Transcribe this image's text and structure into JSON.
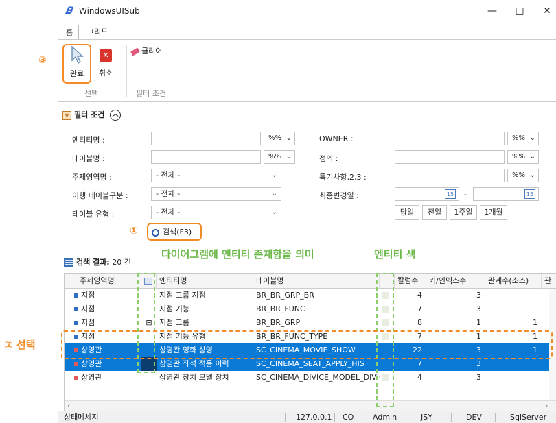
{
  "window": {
    "title": "WindowsUISub",
    "minimize": "—",
    "maximize": "□",
    "close": "✕"
  },
  "menu": {
    "tabs": [
      "홈",
      "그리드"
    ]
  },
  "ribbon": {
    "complete_label": "완료",
    "cancel_label": "취소",
    "clear_label": "클리어",
    "group_select": "선택",
    "group_filter": "필터 조건"
  },
  "filter": {
    "header": "필터 조건",
    "left": [
      {
        "label": "엔티티명 :",
        "kind": "text",
        "op": "%%"
      },
      {
        "label": "테이블명 :",
        "kind": "text",
        "op": "%%"
      },
      {
        "label": "주제영역명 :",
        "kind": "combo",
        "value": "- 전체 -"
      },
      {
        "label": "이행 테이블구분 :",
        "kind": "combo",
        "value": "- 전체 -"
      },
      {
        "label": "테이블 유형 :",
        "kind": "combo",
        "value": "- 전체 -"
      }
    ],
    "right": [
      {
        "label": "OWNER :",
        "op": "%%"
      },
      {
        "label": "정의 :",
        "op": "%%"
      },
      {
        "label": "특기사항,2,3 :",
        "op": "%%"
      },
      {
        "label": "최종변경일 :"
      }
    ],
    "date_sep": "-",
    "calendar_day": "15",
    "date_buttons": [
      "당일",
      "전일",
      "1주일",
      "1개월"
    ],
    "search_label": "검색(F3)"
  },
  "results": {
    "label": "검색 결과:",
    "count": "20 건",
    "columns": [
      "주제영역명",
      "",
      "엔티티명",
      "테이블명",
      "",
      "칼럼수",
      "키/인덱스수",
      "관계수(소스)",
      "관"
    ],
    "rows": [
      {
        "area": "지점",
        "color": "#2f6fbf",
        "marker": "",
        "entity": "지점 그룹 지점",
        "table": "BR_BR_GRP_BR",
        "cols": "4",
        "keys": "3",
        "rels": "",
        "selected": false
      },
      {
        "area": "지점",
        "color": "#2f6fbf",
        "marker": "",
        "entity": "지점 기능",
        "table": "BR_BR_FUNC",
        "cols": "7",
        "keys": "3",
        "rels": "",
        "selected": false
      },
      {
        "area": "지점",
        "color": "#2f6fbf",
        "marker": "⊟",
        "entity": "지점 그룹",
        "table": "BR_BR_GRP",
        "cols": "8",
        "keys": "1",
        "rels": "1",
        "selected": false
      },
      {
        "area": "지점",
        "color": "#2f6fbf",
        "marker": "",
        "entity": "지점 기능 유형",
        "table": "BR_BR_FUNC_TYPE",
        "cols": "7",
        "keys": "1",
        "rels": "1",
        "selected": false
      },
      {
        "area": "상영관",
        "color": "#e05a5a",
        "marker": "",
        "entity": "상영관 영화 상영",
        "table": "SC_CINEMA_MOVIE_SHOW",
        "cols": "22",
        "keys": "3",
        "rels": "1",
        "selected": true
      },
      {
        "area": "상영관",
        "color": "#e05a5a",
        "marker": "",
        "entity": "상영관 좌석 적용 이력",
        "table": "SC_CINEMA_SEAT_APPLY_HIS",
        "cols": "7",
        "keys": "3",
        "rels": "",
        "selected": true
      },
      {
        "area": "상영관",
        "color": "#e05a5a",
        "marker": "",
        "entity": "상영관 장치 모델 장치",
        "table": "SC_CINEMA_DIVICE_MODEL_DIVIC",
        "cols": "4",
        "keys": "3",
        "rels": "",
        "selected": false
      }
    ]
  },
  "status": {
    "message": "상태메세지",
    "ip": "127.0.0.1",
    "co": "CO",
    "user": "Admin",
    "jsy": "JSY",
    "env": "DEV",
    "db": "SqlServer"
  },
  "annotations": {
    "n1": "①",
    "n2": "② 선택",
    "n3": "③",
    "entity_exists": "다이어그램에 엔티티 존재함을 의미",
    "entity_color": "엔티티 색"
  },
  "colors": {
    "accent": "#f28c28",
    "selection": "#0a7ad6",
    "green_annotation": "#6db84a"
  }
}
